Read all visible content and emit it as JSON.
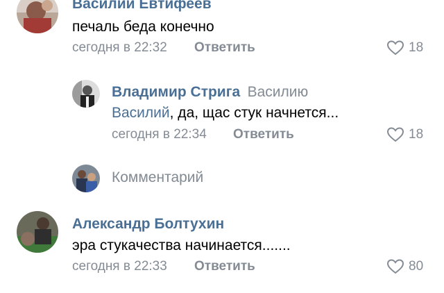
{
  "comments": [
    {
      "author": "Василий Евтифеев",
      "text": "печаль беда конечно",
      "time": "сегодня в 22:32",
      "reply_label": "Ответить",
      "likes": "18"
    },
    {
      "author": "Владимир Стрига",
      "reply_to": "Василию",
      "mention": "Василий",
      "text_rest": ", да, щас стук начнется...",
      "time": "сегодня в 22:34",
      "reply_label": "Ответить",
      "likes": "18"
    },
    {
      "author": "Александр Болтухин",
      "text": "эра стукачества начинается.......",
      "time": "сегодня в 22:33",
      "reply_label": "Ответить",
      "likes": "80"
    }
  ],
  "comment_box": {
    "placeholder": "Комментарий"
  },
  "colors": {
    "name": "#4a6f95",
    "meta": "#848b94",
    "text": "#000000"
  }
}
